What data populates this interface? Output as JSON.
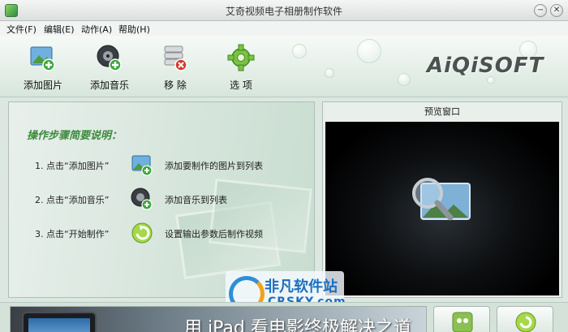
{
  "window": {
    "title": "艾奇视频电子相册制作软件",
    "minimize_symbol": "−",
    "close_symbol": "✕"
  },
  "menu": {
    "items": [
      {
        "label": "文件(F)"
      },
      {
        "label": "编辑(E)"
      },
      {
        "label": "动作(A)"
      },
      {
        "label": "帮助(H)"
      }
    ]
  },
  "toolbar": {
    "add_image": {
      "label": "添加图片",
      "icon": "add-image-icon"
    },
    "add_music": {
      "label": "添加音乐",
      "icon": "add-music-icon"
    },
    "remove": {
      "label": "移  除",
      "icon": "remove-icon"
    },
    "options": {
      "label": "选  项",
      "icon": "gear-icon"
    },
    "logo": "AiQiSOFT"
  },
  "guide": {
    "title": "操作步骤简要说明：",
    "steps": [
      {
        "text": "1. 点击“添加图片”",
        "desc": "添加要制作的图片到列表",
        "icon": "add-image-icon"
      },
      {
        "text": "2. 点击“添加音乐”",
        "desc": "添加音乐到列表",
        "icon": "add-music-icon"
      },
      {
        "text": "3. 点击“开始制作”",
        "desc": "设置输出参数后制作视频",
        "icon": "start-icon"
      }
    ]
  },
  "preview": {
    "title": "预览窗口",
    "icon": "magnifier-photo-icon"
  },
  "watermark": {
    "cn": "非凡软件站",
    "en": "CRSKY.com"
  },
  "banner": {
    "text": "用 iPad 看电影终极解决之道"
  },
  "colors": {
    "accent_green": "#3d8a3d",
    "watermark_blue": "#1c6fbf"
  }
}
